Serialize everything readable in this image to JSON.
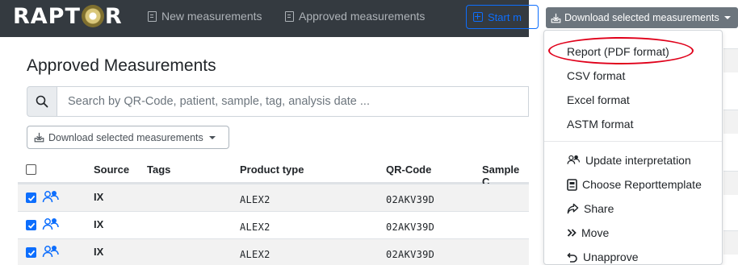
{
  "colors": {
    "navbar_bg": "#343a40",
    "primary": "#0d6efd",
    "secondary_btn": "#6c757d",
    "annotation": "#e0001a"
  },
  "navbar": {
    "brand": "RAPTOR",
    "brand_left": "RAPT",
    "brand_right": "R",
    "new_measurements": "New measurements",
    "approved_measurements": "Approved measurements",
    "start_button": "Start m"
  },
  "page": {
    "title": "Approved Measurements",
    "search_placeholder": "Search by QR-Code, patient, sample, tag, analysis date ...",
    "download_button": "Download selected measurements"
  },
  "table": {
    "columns": [
      "Source",
      "Tags",
      "Product type",
      "QR-Code",
      "Sample C"
    ],
    "rows": [
      {
        "selected": true,
        "source": "IX",
        "tags": "",
        "product_type": "ALEX2",
        "qr_code": "02AKV39D"
      },
      {
        "selected": true,
        "source": "IX",
        "tags": "",
        "product_type": "ALEX2",
        "qr_code": "02AKV39D"
      },
      {
        "selected": true,
        "source": "IX",
        "tags": "",
        "product_type": "ALEX2",
        "qr_code": "02AKV39D"
      }
    ]
  },
  "dropdown": {
    "button": "Download selected measurements",
    "items": [
      {
        "label": "Report (PDF format)",
        "icon": ""
      },
      {
        "label": "CSV format",
        "icon": ""
      },
      {
        "label": "Excel format",
        "icon": ""
      },
      {
        "label": "ASTM format",
        "icon": ""
      },
      {
        "label": "Update interpretation",
        "icon": "users-icon"
      },
      {
        "label": "Choose Reporttemplate",
        "icon": "template-icon"
      },
      {
        "label": "Share",
        "icon": "share-icon"
      },
      {
        "label": "Move",
        "icon": "double-chevron-icon"
      },
      {
        "label": "Unapprove",
        "icon": "undo-icon"
      }
    ],
    "highlighted_item": "Report (PDF format)"
  }
}
